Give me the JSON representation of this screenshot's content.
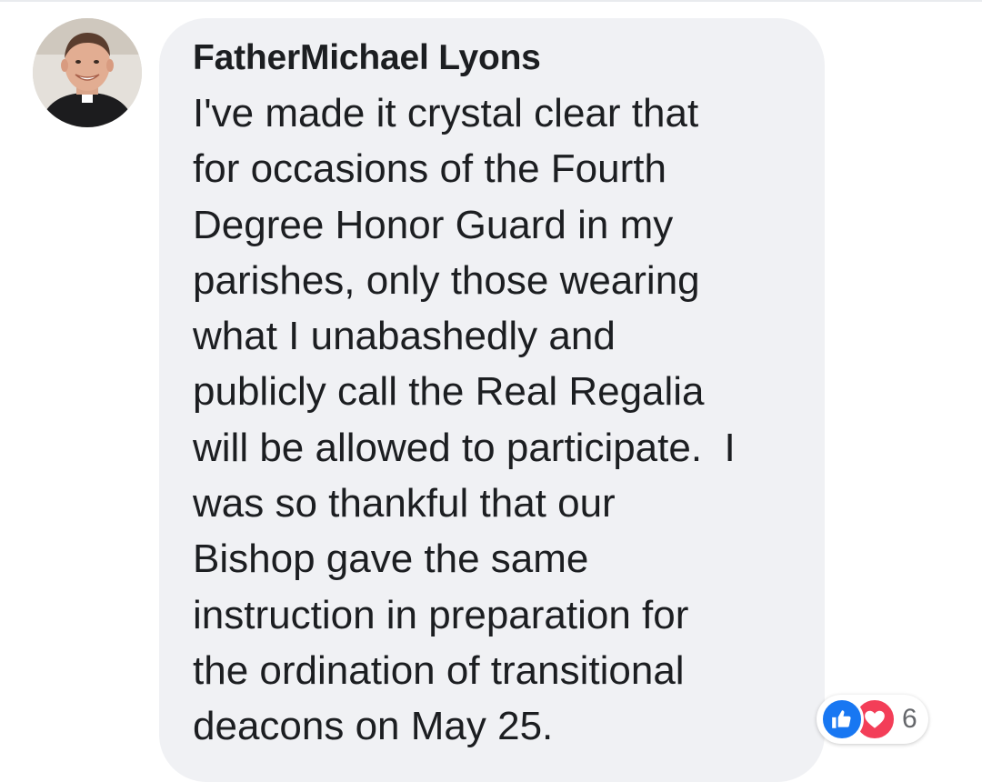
{
  "comment": {
    "author": "FatherMichael Lyons",
    "text_lines": [
      "I've made it crystal clear that",
      "for occasions of the Fourth",
      "Degree Honor Guard in my",
      "parishes, only those wearing",
      "what I unabashedly and",
      "publicly call the Real Regalia",
      "will be allowed to participate.  I",
      "was so thankful that our",
      "Bishop gave the same",
      "instruction in preparation for",
      "the ordination of transitional",
      "deacons on May 25."
    ],
    "reactions": {
      "icons": [
        "like-icon",
        "love-icon"
      ],
      "count": "6"
    }
  },
  "colors": {
    "bubble": "#f0f1f4",
    "text": "#1c1e21",
    "like": "#1877f2",
    "love": "#f33e58",
    "count": "#65676b"
  }
}
